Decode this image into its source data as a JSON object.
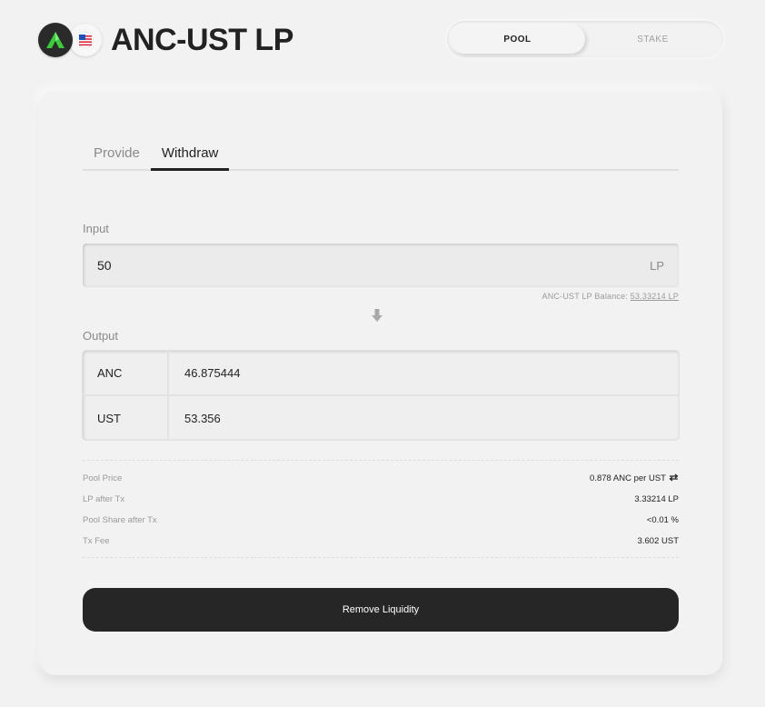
{
  "header": {
    "title": "ANC-UST LP",
    "icons": [
      "anchor-logo-icon",
      "ust-logo-icon"
    ]
  },
  "top_tabs": {
    "pool": "POOL",
    "stake": "STAKE",
    "active": "POOL"
  },
  "sub_tabs": {
    "provide": "Provide",
    "withdraw": "Withdraw",
    "active": "Withdraw"
  },
  "input": {
    "label": "Input",
    "value": "50",
    "unit": "LP",
    "balance_label": "ANC-UST LP Balance:",
    "balance_value": "53.33214 LP"
  },
  "output": {
    "label": "Output",
    "rows": [
      {
        "token": "ANC",
        "amount": "46.875444"
      },
      {
        "token": "UST",
        "amount": "53.356"
      }
    ]
  },
  "info": [
    {
      "label": "Pool Price",
      "value": "0.878 ANC per UST"
    },
    {
      "label": "LP after Tx",
      "value": "3.33214 LP"
    },
    {
      "label": "Pool Share after Tx",
      "value": "<0.01 %"
    },
    {
      "label": "Tx Fee",
      "value": "3.602 UST"
    }
  ],
  "button": {
    "label": "Remove Liquidity"
  },
  "colors": {
    "background": "#f2f2f2",
    "text": "#222222",
    "muted": "#8a8a8a",
    "button": "#262626",
    "anchor_green": "#4bdb4b"
  }
}
